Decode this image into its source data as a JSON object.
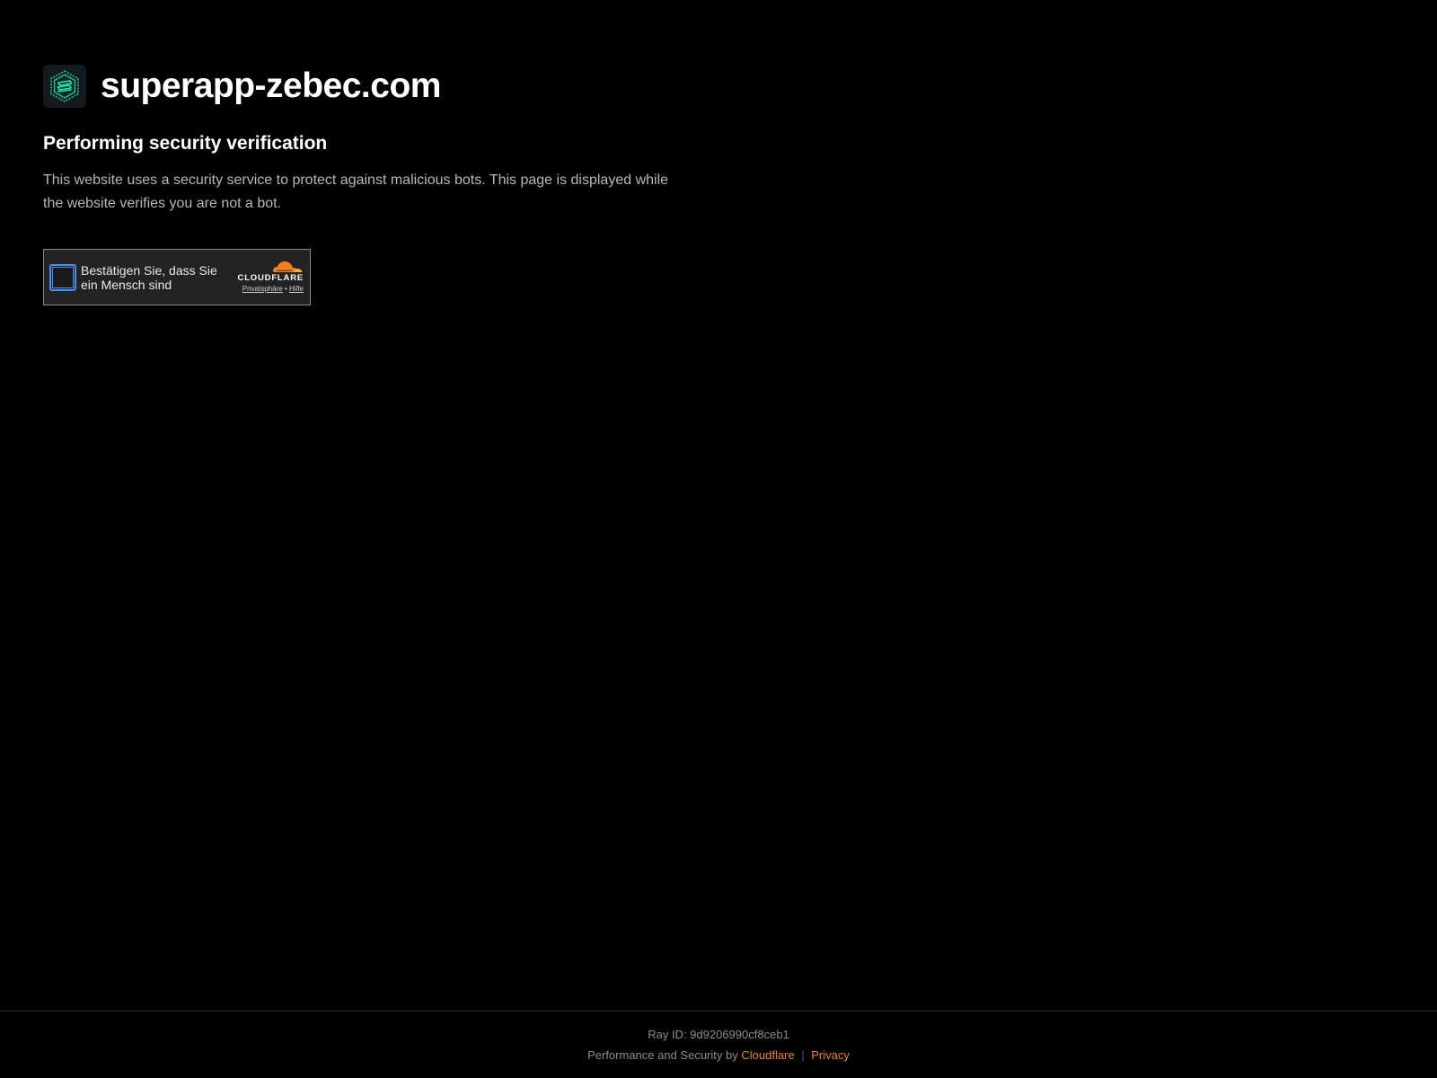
{
  "site": {
    "name": "superapp-zebec.com",
    "logo_icon": "zebec-logo-icon"
  },
  "verification": {
    "title": "Performing security verification",
    "description": "This website uses a security service to protect against malicious bots. This page is displayed while the website verifies you are not a bot."
  },
  "widget": {
    "checkbox_label": "Bestätigen Sie, dass Sie ein Mensch sind",
    "checked": false,
    "brand": "CLOUDFLARE",
    "privacy_link": "Privatsphäre",
    "link_separator": "•",
    "help_link": "Hilfe"
  },
  "footer": {
    "ray_id": "Ray ID: 9d9206990cf8ceb1",
    "perf_text": "Performance and Security by",
    "cloudflare_link": "Cloudflare",
    "separator": "|",
    "privacy_link": "Privacy"
  },
  "colors": {
    "background": "#000000",
    "accent": "#f38020",
    "checkbox_border": "#4d8cf5",
    "logo_green": "#18c9a2"
  }
}
